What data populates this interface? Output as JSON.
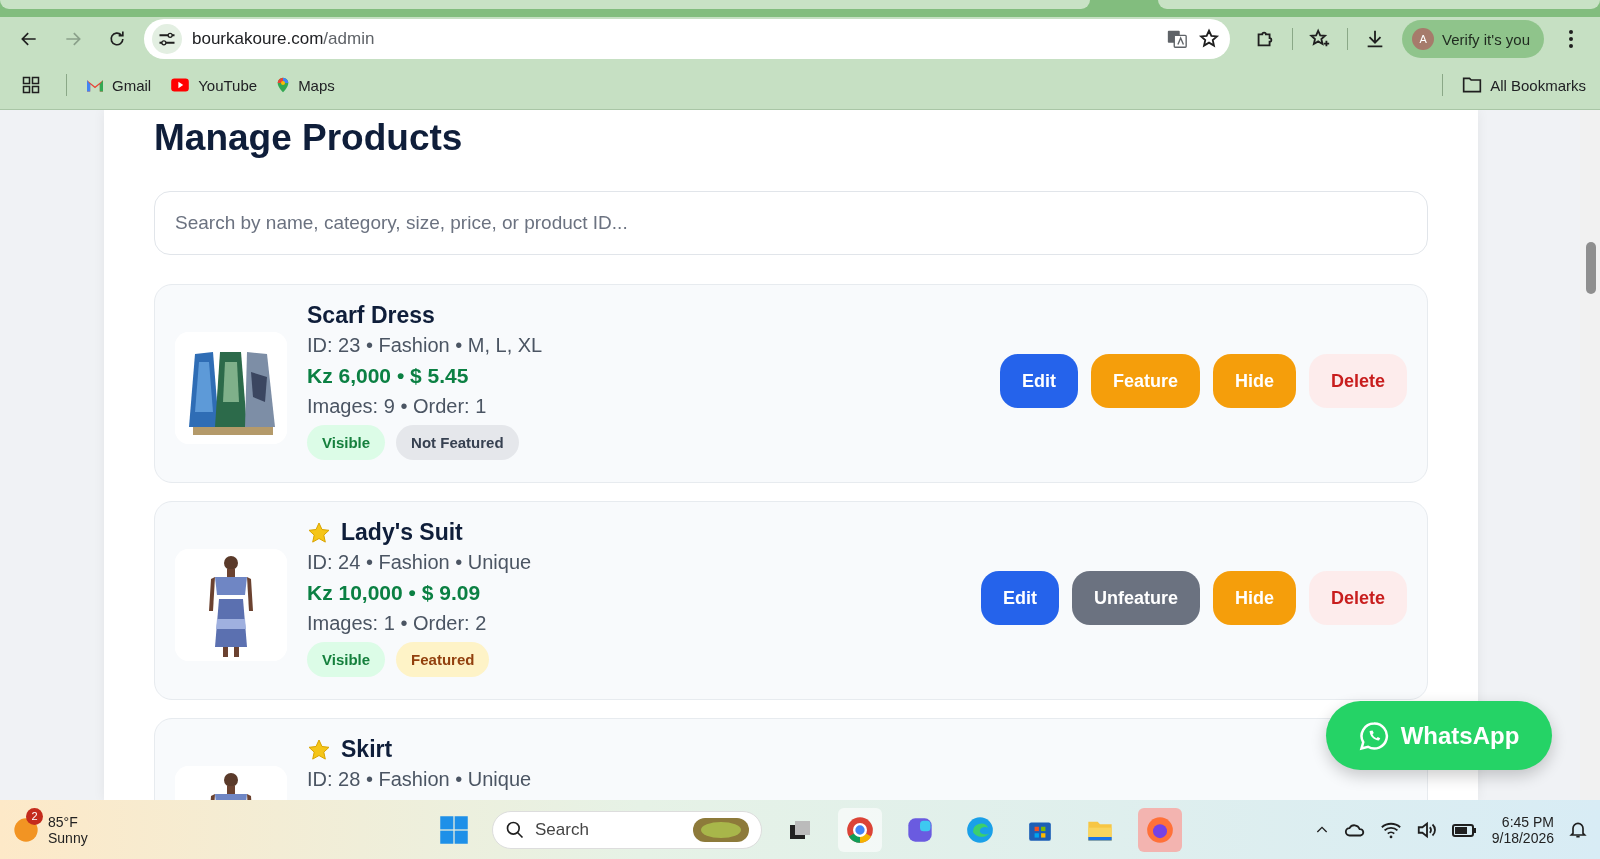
{
  "browser": {
    "url_host": "bourkakoure.com",
    "url_path": "/admin",
    "profile_initial": "A",
    "profile_label": "Verify it's you",
    "bookmarks": [
      {
        "label": "Gmail",
        "kind": "gmail"
      },
      {
        "label": "YouTube",
        "kind": "youtube"
      },
      {
        "label": "Maps",
        "kind": "maps"
      }
    ],
    "all_bookmarks": "All Bookmarks"
  },
  "page": {
    "title": "Manage Products",
    "search": {
      "placeholder": "Search by name, category, size, price, or product ID..."
    },
    "products": [
      {
        "name": "Scarf Dress",
        "featured": false,
        "meta": "ID: 23 • Fashion • M, L, XL",
        "price": "Kz 6,000 • $ 5.45",
        "info": "Images: 9 • Order: 1",
        "badges": [
          {
            "label": "Visible",
            "kind": "visible"
          },
          {
            "label": "Not Featured",
            "kind": "neutral"
          }
        ],
        "actions": [
          {
            "label": "Edit",
            "kind": "edit"
          },
          {
            "label": "Feature",
            "kind": "warn"
          },
          {
            "label": "Hide",
            "kind": "warn"
          },
          {
            "label": "Delete",
            "kind": "danger"
          }
        ]
      },
      {
        "name": "Lady's Suit",
        "featured": true,
        "meta": "ID: 24 • Fashion • Unique",
        "price": "Kz 10,000 • $ 9.09",
        "info": "Images: 1 • Order: 2",
        "badges": [
          {
            "label": "Visible",
            "kind": "visible"
          },
          {
            "label": "Featured",
            "kind": "featured"
          }
        ],
        "actions": [
          {
            "label": "Edit",
            "kind": "edit"
          },
          {
            "label": "Unfeature",
            "kind": "neutral"
          },
          {
            "label": "Hide",
            "kind": "warn"
          },
          {
            "label": "Delete",
            "kind": "danger"
          }
        ]
      },
      {
        "name": "Skirt",
        "featured": true,
        "meta": "ID: 28 • Fashion • Unique"
      }
    ],
    "whatsapp": "WhatsApp"
  },
  "taskbar": {
    "weather_badge": "2",
    "temperature": "85°F",
    "condition": "Sunny",
    "search_placeholder": "Search",
    "time": "6:45 PM",
    "date": "9/18/2026"
  }
}
